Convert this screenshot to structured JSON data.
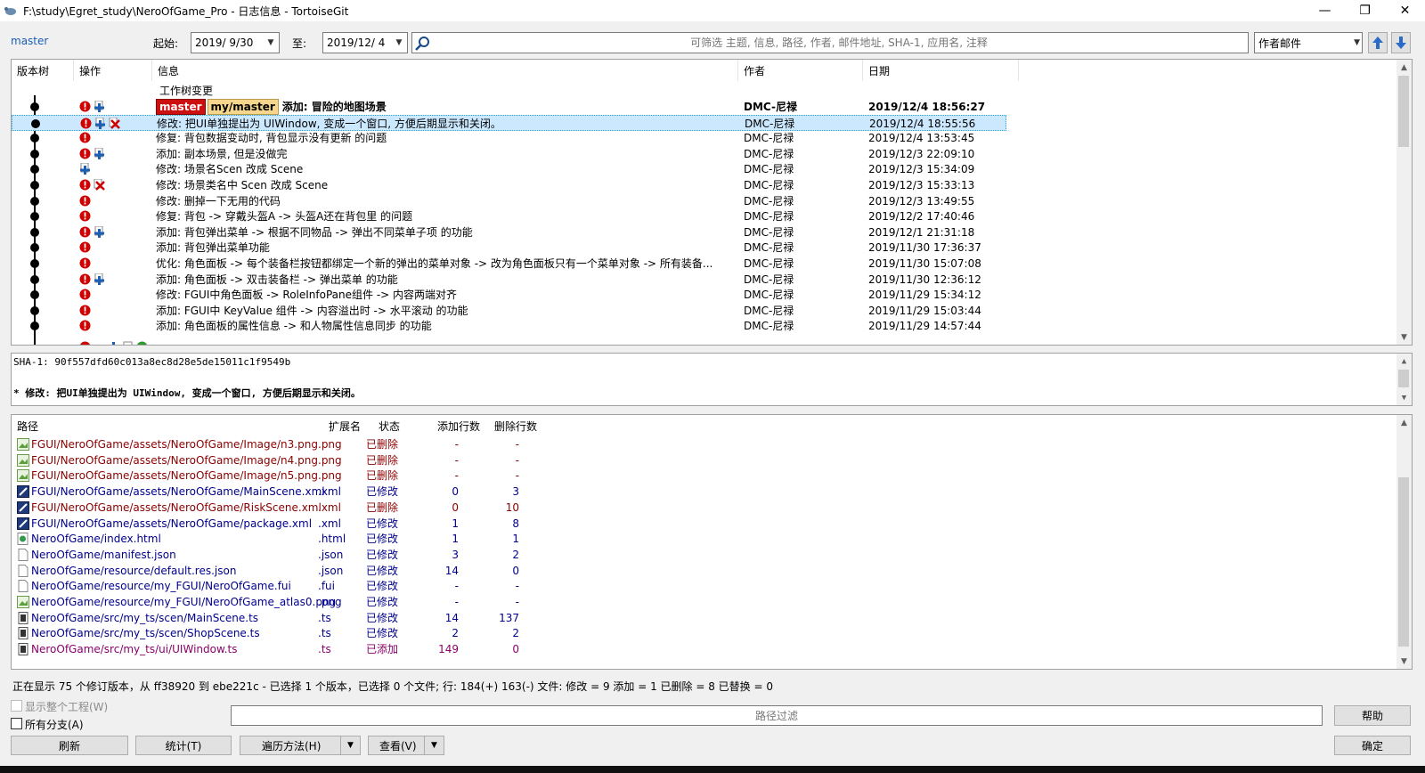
{
  "window": {
    "title": "F:\\study\\Egret_study\\NeroOfGame_Pro - 日志信息 - TortoiseGit",
    "minimize": "—",
    "restore": "❐",
    "close": "✕"
  },
  "toolbar": {
    "branch": "master",
    "from_label": "起始:",
    "from_date": "2019/ 9/30",
    "to_label": "至:",
    "to_date": "2019/12/ 4",
    "search_placeholder": "可筛选 主题, 信息, 路径, 作者, 邮件地址, SHA-1, 应用名, 注释",
    "filter_field": "作者邮件"
  },
  "log": {
    "headers": {
      "graph": "版本树",
      "actions": "操作",
      "message": "信息",
      "author": "作者",
      "date": "日期"
    },
    "working_tree": "工作树变更",
    "rows": [
      {
        "msg": "添加: 冒险的地图场景",
        "author": "DMC-尼禄",
        "date": "2019/12/4 18:56:27",
        "tags": [
          "master",
          "my/master"
        ],
        "bold": true,
        "icons": [
          "mod",
          "add"
        ]
      },
      {
        "msg": "修改: 把UI单独提出为 UIWindow, 变成一个窗口, 方便后期显示和关闭。",
        "author": "DMC-尼禄",
        "date": "2019/12/4 18:55:56",
        "selected": true,
        "icons": [
          "mod",
          "add",
          "del"
        ]
      },
      {
        "msg": "修复: 背包数据变动时, 背包显示没有更新 的问题",
        "author": "DMC-尼禄",
        "date": "2019/12/4 13:53:45",
        "icons": [
          "mod"
        ]
      },
      {
        "msg": "添加: 副本场景, 但是没做完",
        "author": "DMC-尼禄",
        "date": "2019/12/3 22:09:10",
        "icons": [
          "mod",
          "add"
        ]
      },
      {
        "msg": "修改: 场景名Scen 改成 Scene",
        "author": "DMC-尼禄",
        "date": "2019/12/3 15:34:09",
        "icons": [
          "add"
        ]
      },
      {
        "msg": "修改: 场景类名中 Scen 改成 Scene",
        "author": "DMC-尼禄",
        "date": "2019/12/3 15:33:13",
        "icons": [
          "mod",
          "del"
        ]
      },
      {
        "msg": "修改: 删掉一下无用的代码",
        "author": "DMC-尼禄",
        "date": "2019/12/3 13:49:55",
        "icons": [
          "mod"
        ]
      },
      {
        "msg": "修复: 背包 -> 穿戴头盔A -> 头盔A还在背包里 的问题",
        "author": "DMC-尼禄",
        "date": "2019/12/2 17:40:46",
        "icons": [
          "mod"
        ]
      },
      {
        "msg": "添加: 背包弹出菜单 -> 根据不同物品 -> 弹出不同菜单子项 的功能",
        "author": "DMC-尼禄",
        "date": "2019/12/1 21:31:18",
        "icons": [
          "mod",
          "add"
        ]
      },
      {
        "msg": "添加: 背包弹出菜单功能",
        "author": "DMC-尼禄",
        "date": "2019/11/30 17:36:37",
        "icons": [
          "mod"
        ]
      },
      {
        "msg": "优化: 角色面板 -> 每个装备栏按钮都绑定一个新的弹出的菜单对象 -> 改为角色面板只有一个菜单对象 -> 所有装备...",
        "author": "DMC-尼禄",
        "date": "2019/11/30 15:07:08",
        "icons": [
          "mod"
        ]
      },
      {
        "msg": "添加: 角色面板 -> 双击装备栏 -> 弹出菜单 的功能",
        "author": "DMC-尼禄",
        "date": "2019/11/30 12:36:12",
        "icons": [
          "mod",
          "add"
        ]
      },
      {
        "msg": "修改: FGUI中角色面板 -> RoleInfoPane组件 -> 内容两端对齐",
        "author": "DMC-尼禄",
        "date": "2019/11/29 15:34:12",
        "icons": [
          "mod"
        ]
      },
      {
        "msg": "添加: FGUI中 KeyValue 组件 -> 内容溢出时 -> 水平滚动 的功能",
        "author": "DMC-尼禄",
        "date": "2019/11/29 15:03:44",
        "icons": [
          "mod"
        ]
      },
      {
        "msg": "添加: 角色面板的属性信息 -> 和人物属性信息同步 的功能",
        "author": "DMC-尼禄",
        "date": "2019/11/29 14:57:44",
        "icons": [
          "mod"
        ]
      }
    ]
  },
  "message": {
    "sha": "SHA-1: 90f557dfd60c013a8ec8d28e5de15011c1f9549b",
    "body": "* 修改: 把UI单独提出为 UIWindow, 变成一个窗口, 方便后期显示和关闭。"
  },
  "files": {
    "headers": {
      "path": "路径",
      "ext": "扩展名",
      "status": "状态",
      "added": "添加行数",
      "removed": "删除行数"
    },
    "rows": [
      {
        "path": "FGUI/NeroOfGame/assets/NeroOfGame/Image/n3.png",
        "ext": ".png",
        "status": "已删除",
        "added": "-",
        "removed": "-",
        "icon": "png",
        "color": "#8b0000"
      },
      {
        "path": "FGUI/NeroOfGame/assets/NeroOfGame/Image/n4.png",
        "ext": ".png",
        "status": "已删除",
        "added": "-",
        "removed": "-",
        "icon": "png",
        "color": "#8b0000"
      },
      {
        "path": "FGUI/NeroOfGame/assets/NeroOfGame/Image/n5.png",
        "ext": ".png",
        "status": "已删除",
        "added": "-",
        "removed": "-",
        "icon": "png",
        "color": "#8b0000"
      },
      {
        "path": "FGUI/NeroOfGame/assets/NeroOfGame/MainScene.xml",
        "ext": ".xml",
        "status": "已修改",
        "added": "0",
        "removed": "3",
        "icon": "xml",
        "color": "#00008b"
      },
      {
        "path": "FGUI/NeroOfGame/assets/NeroOfGame/RiskScene.xml",
        "ext": ".xml",
        "status": "已删除",
        "added": "0",
        "removed": "10",
        "icon": "xml",
        "color": "#8b0000"
      },
      {
        "path": "FGUI/NeroOfGame/assets/NeroOfGame/package.xml",
        "ext": ".xml",
        "status": "已修改",
        "added": "1",
        "removed": "8",
        "icon": "xml",
        "color": "#00008b"
      },
      {
        "path": "NeroOfGame/index.html",
        "ext": ".html",
        "status": "已修改",
        "added": "1",
        "removed": "1",
        "icon": "html",
        "color": "#00008b"
      },
      {
        "path": "NeroOfGame/manifest.json",
        "ext": ".json",
        "status": "已修改",
        "added": "3",
        "removed": "2",
        "icon": "file",
        "color": "#00008b"
      },
      {
        "path": "NeroOfGame/resource/default.res.json",
        "ext": ".json",
        "status": "已修改",
        "added": "14",
        "removed": "0",
        "icon": "file",
        "color": "#00008b"
      },
      {
        "path": "NeroOfGame/resource/my_FGUI/NeroOfGame.fui",
        "ext": ".fui",
        "status": "已修改",
        "added": "-",
        "removed": "-",
        "icon": "file",
        "color": "#00008b"
      },
      {
        "path": "NeroOfGame/resource/my_FGUI/NeroOfGame_atlas0.png",
        "ext": ".png",
        "status": "已修改",
        "added": "-",
        "removed": "-",
        "icon": "png",
        "color": "#00008b"
      },
      {
        "path": "NeroOfGame/src/my_ts/scen/MainScene.ts",
        "ext": ".ts",
        "status": "已修改",
        "added": "14",
        "removed": "137",
        "icon": "ts",
        "color": "#00008b"
      },
      {
        "path": "NeroOfGame/src/my_ts/scen/ShopScene.ts",
        "ext": ".ts",
        "status": "已修改",
        "added": "2",
        "removed": "2",
        "icon": "ts",
        "color": "#00008b"
      },
      {
        "path": "NeroOfGame/src/my_ts/ui/UIWindow.ts",
        "ext": ".ts",
        "status": "已添加",
        "added": "149",
        "removed": "0",
        "icon": "ts",
        "color": "#8b006b"
      }
    ]
  },
  "status_text": "正在显示 75 个修订版本，从 ff38920 到 ebe221c - 已选择 1 个版本，已选择 0 个文件; 行: 184(+) 163(-) 文件: 修改 = 9 添加 = 1 已删除 = 8 已替换 = 0",
  "options": {
    "show_whole_project": "显示整个工程(W)",
    "all_branches": "所有分支(A)",
    "path_filter": "路径过滤"
  },
  "buttons": {
    "refresh": "刷新",
    "stats": "统计(T)",
    "walk": "遍历方法(H)",
    "view": "查看(V)",
    "help": "帮助",
    "ok": "确定"
  }
}
